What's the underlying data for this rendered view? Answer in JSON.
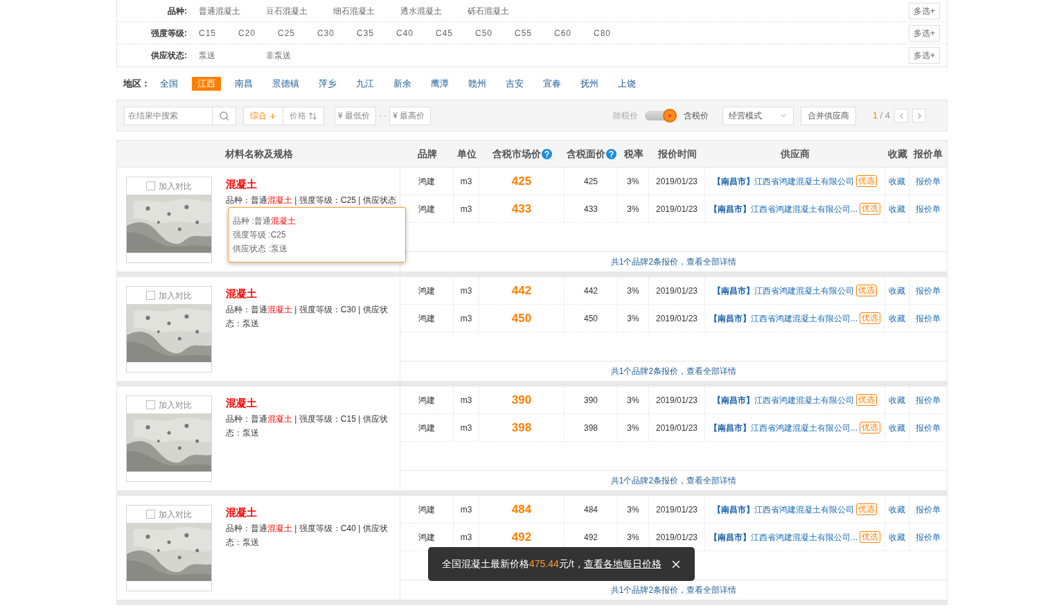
{
  "filters": [
    {
      "label": "品种:",
      "options": [
        "普通混凝土",
        "豆石混凝土",
        "细石混凝土",
        "透水混凝土",
        "砾石混凝土"
      ],
      "button": "多选+"
    },
    {
      "label": "强度等级:",
      "options": [
        "C15",
        "C20",
        "C25",
        "C30",
        "C35",
        "C40",
        "C45",
        "C50",
        "C55",
        "C60",
        "C80"
      ],
      "button": "多选+"
    },
    {
      "label": "供应状态:",
      "options": [
        "泵送",
        "非泵送"
      ],
      "button": "多选+"
    }
  ],
  "regions": {
    "label": "地区：",
    "items": [
      {
        "label": "全国",
        "selected": false
      },
      {
        "label": "江西",
        "selected": true
      },
      {
        "label": "南昌",
        "selected": false
      },
      {
        "label": "景德镇",
        "selected": false
      },
      {
        "label": "萍乡",
        "selected": false
      },
      {
        "label": "九江",
        "selected": false
      },
      {
        "label": "新余",
        "selected": false
      },
      {
        "label": "鹰潭",
        "selected": false
      },
      {
        "label": "赣州",
        "selected": false
      },
      {
        "label": "吉安",
        "selected": false
      },
      {
        "label": "宜春",
        "selected": false
      },
      {
        "label": "抚州",
        "selected": false
      },
      {
        "label": "上饶",
        "selected": false
      }
    ]
  },
  "toolbar": {
    "search_placeholder": "在结果中搜索",
    "sorts": [
      {
        "label": "综合",
        "selected": true,
        "kind": "down"
      },
      {
        "label": "价格",
        "selected": false,
        "kind": "updown"
      }
    ],
    "min_placeholder": "¥ 最低价",
    "range_sep": "- -",
    "max_placeholder": "¥ 最高价",
    "tax_off_label": "除税价",
    "tax_on": true,
    "tax_on_label": "含税价",
    "mode_select": "经营模式",
    "merge_button": "合并供应商",
    "page_current": "1",
    "page_total": "/ 4"
  },
  "columns": [
    {
      "label": "材料名称及规格",
      "help": false
    },
    {
      "label": "品牌",
      "help": false
    },
    {
      "label": "单位",
      "help": false
    },
    {
      "label": "含税市场价",
      "help": true
    },
    {
      "label": "含税面价",
      "help": true
    },
    {
      "label": "税率",
      "help": false
    },
    {
      "label": "报价时间",
      "help": false
    },
    {
      "label": "供应商",
      "help": false
    },
    {
      "label": "收藏",
      "help": false
    },
    {
      "label": "报价单",
      "help": false
    }
  ],
  "products": [
    {
      "title": "混凝土",
      "compare_label": "加入对比",
      "compare_checked": false,
      "spec": [
        {
          "text": "品种：普通",
          "highlight": false
        },
        {
          "text": "混凝土",
          "highlight": true
        },
        {
          "text": " | 强度等级：C25 | 供应状态",
          "highlight": false
        }
      ],
      "tooltip": [
        [
          {
            "text": "品种 :普通",
            "highlight": false
          },
          {
            "text": "混凝土",
            "highlight": true
          }
        ],
        [
          {
            "text": "强度等级 :C25",
            "highlight": false
          }
        ],
        [
          {
            "text": "供应状态 :泵送",
            "highlight": false
          }
        ]
      ],
      "quotes": [
        {
          "brand": "鸿建",
          "unit": "m3",
          "price": "425",
          "face_price": "425",
          "tax": "3%",
          "date": "2019/01/23",
          "region": "【南昌市】",
          "supplier": "江西省鸿建混凝土有限公司",
          "badge": "优选",
          "collect": "收藏",
          "quote": "报价单"
        },
        {
          "brand": "鸿建",
          "unit": "m3",
          "price": "433",
          "face_price": "433",
          "tax": "3%",
          "date": "2019/01/23",
          "region": "【南昌市】",
          "supplier": "江西省鸿建混凝土有限公司...",
          "badge": "优选",
          "collect": "收藏",
          "quote": "报价单"
        }
      ],
      "footer": "共1个品牌2条报价，查看全部详情"
    },
    {
      "title": "混凝土",
      "compare_label": "加入对比",
      "compare_checked": false,
      "spec": [
        {
          "text": "品种：普通",
          "highlight": false
        },
        {
          "text": "混凝土",
          "highlight": true
        },
        {
          "text": " | 强度等级：C30 | 供应状态：泵送",
          "highlight": false
        }
      ],
      "quotes": [
        {
          "brand": "鸿建",
          "unit": "m3",
          "price": "442",
          "face_price": "442",
          "tax": "3%",
          "date": "2019/01/23",
          "region": "【南昌市】",
          "supplier": "江西省鸿建混凝土有限公司",
          "badge": "优选",
          "collect": "收藏",
          "quote": "报价单"
        },
        {
          "brand": "鸿建",
          "unit": "m3",
          "price": "450",
          "face_price": "450",
          "tax": "3%",
          "date": "2019/01/23",
          "region": "【南昌市】",
          "supplier": "江西省鸿建混凝土有限公司...",
          "badge": "优选",
          "collect": "收藏",
          "quote": "报价单"
        }
      ],
      "footer": "共1个品牌2条报价，查看全部详情"
    },
    {
      "title": "混凝土",
      "compare_label": "加入对比",
      "compare_checked": false,
      "spec": [
        {
          "text": "品种：普通",
          "highlight": false
        },
        {
          "text": "混凝土",
          "highlight": true
        },
        {
          "text": " | 强度等级：C15 | 供应状态：泵送",
          "highlight": false
        }
      ],
      "quotes": [
        {
          "brand": "鸿建",
          "unit": "m3",
          "price": "390",
          "face_price": "390",
          "tax": "3%",
          "date": "2019/01/23",
          "region": "【南昌市】",
          "supplier": "江西省鸿建混凝土有限公司",
          "badge": "优选",
          "collect": "收藏",
          "quote": "报价单"
        },
        {
          "brand": "鸿建",
          "unit": "m3",
          "price": "398",
          "face_price": "398",
          "tax": "3%",
          "date": "2019/01/23",
          "region": "【南昌市】",
          "supplier": "江西省鸿建混凝土有限公司...",
          "badge": "优选",
          "collect": "收藏",
          "quote": "报价单"
        }
      ],
      "footer": "共1个品牌2条报价，查看全部详情"
    },
    {
      "title": "混凝土",
      "compare_label": "加入对比",
      "compare_checked": false,
      "spec": [
        {
          "text": "品种：普通",
          "highlight": false
        },
        {
          "text": "混凝土",
          "highlight": true
        },
        {
          "text": " | 强度等级：C40 | 供应状态：泵送",
          "highlight": false
        }
      ],
      "quotes": [
        {
          "brand": "鸿建",
          "unit": "m3",
          "price": "484",
          "face_price": "484",
          "tax": "3%",
          "date": "2019/01/23",
          "region": "【南昌市】",
          "supplier": "江西省鸿建混凝土有限公司",
          "badge": "优选",
          "collect": "收藏",
          "quote": "报价单"
        },
        {
          "brand": "鸿建",
          "unit": "m3",
          "price": "492",
          "face_price": "492",
          "tax": "3%",
          "date": "2019/01/23",
          "region": "【南昌市】",
          "supplier": "江西省鸿建混凝土有限公司...",
          "badge": "优选",
          "collect": "收藏",
          "quote": "报价单"
        }
      ],
      "footer": "共1个品牌2条报价，查看全部详情"
    }
  ],
  "toast": {
    "prefix": "全国混凝土最新价格",
    "price": "475.44",
    "suffix": "元/t，",
    "link": "查看各地每日价格"
  }
}
